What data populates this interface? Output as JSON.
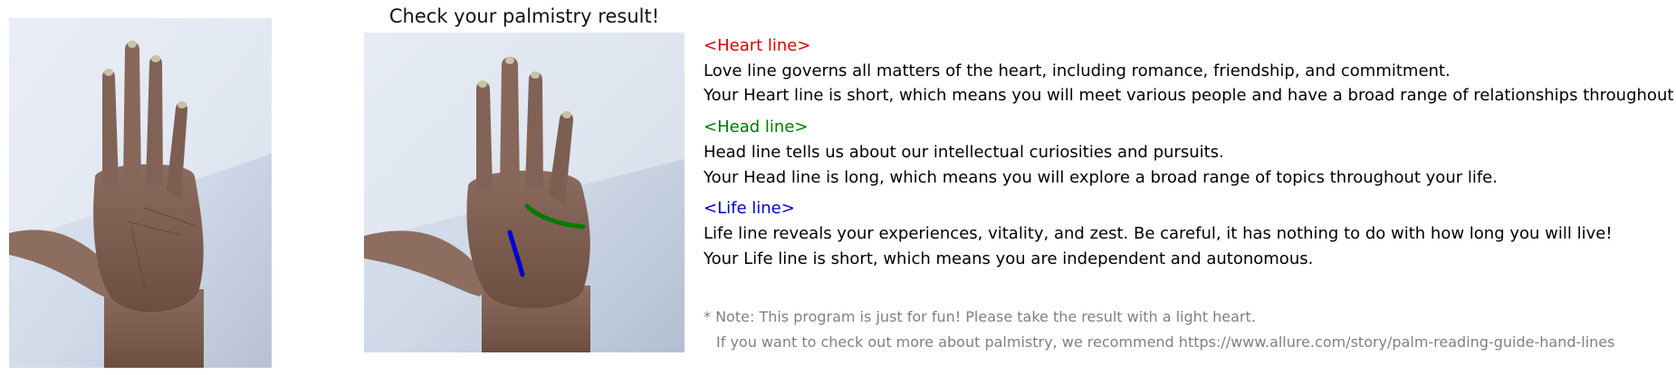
{
  "title": "Check your palmistry result!",
  "sections": [
    {
      "heading": "<Heart line>",
      "color": "#dd0000",
      "description": "Love line governs all matters of the heart, including romance, friendship, and commitment.",
      "result": "Your Heart line is short, which means you will meet various people and have a broad range of relationships throughout your life."
    },
    {
      "heading": "<Head line>",
      "color": "#007a00",
      "description": "Head line tells us about our intellectual curiosities and pursuits.",
      "result": "Your Head line is long, which means you will explore a broad range of topics throughout your life."
    },
    {
      "heading": "<Life line>",
      "color": "#0000cc",
      "description": "Life line reveals your experiences, vitality, and zest. Be careful, it has nothing to do with how long you will live!",
      "result": "Your Life line is short, which means you are independent and autonomous."
    }
  ],
  "note": {
    "line1": "* Note: This program is just for fun! Please take the result with a light heart.",
    "line2": "If you want to check out more about palmistry, we recommend https://www.allure.com/story/palm-reading-guide-hand-lines",
    "color": "#808080"
  }
}
